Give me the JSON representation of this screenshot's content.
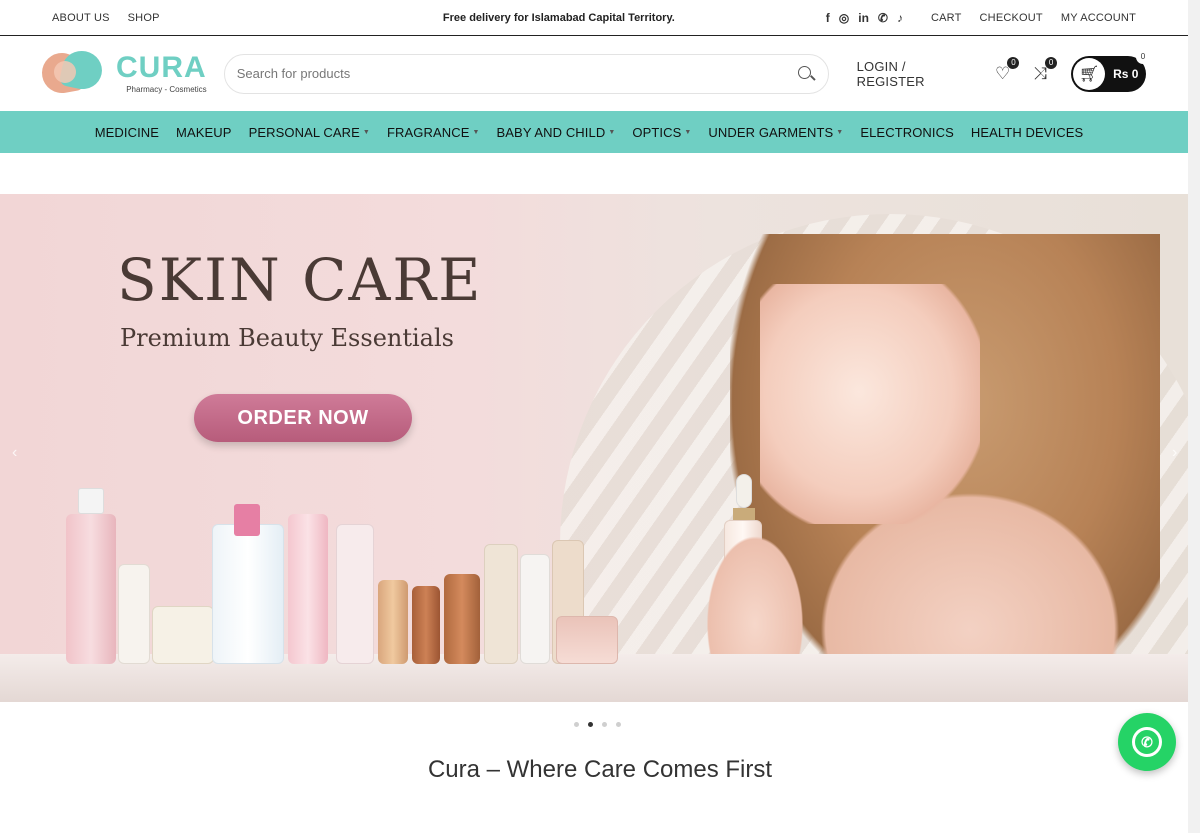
{
  "topbar": {
    "links_left": [
      "ABOUT US",
      "SHOP"
    ],
    "announcement": "Free delivery for Islamabad Capital Territory.",
    "social": [
      "facebook-icon",
      "instagram-icon",
      "linkedin-icon",
      "whatsapp-icon",
      "tiktok-icon"
    ],
    "social_glyphs": [
      "f",
      "◎",
      "in",
      "✆",
      "♪"
    ],
    "links_right": [
      "CART",
      "CHECKOUT",
      "MY ACCOUNT"
    ]
  },
  "header": {
    "brand": "CURA",
    "tagline": "Pharmacy - Cosmetics",
    "search_placeholder": "Search for products",
    "login_label": "LOGIN / REGISTER",
    "wishlist_count": "0",
    "compare_count": "0",
    "cart_amount": "Rs 0",
    "cart_count": "0"
  },
  "nav": {
    "items": [
      {
        "label": "MEDICINE",
        "dropdown": false
      },
      {
        "label": "MAKEUP",
        "dropdown": false
      },
      {
        "label": "PERSONAL CARE",
        "dropdown": true
      },
      {
        "label": "FRAGRANCE",
        "dropdown": true
      },
      {
        "label": "BABY AND CHILD",
        "dropdown": true
      },
      {
        "label": "OPTICS",
        "dropdown": true
      },
      {
        "label": "UNDER GARMENTS",
        "dropdown": true
      },
      {
        "label": "ELECTRONICS",
        "dropdown": false
      },
      {
        "label": "HEALTH DEVICES",
        "dropdown": false
      }
    ]
  },
  "hero": {
    "title": "SKIN CARE",
    "subtitle": "Premium Beauty Essentials",
    "cta": "ORDER NOW",
    "slide_count": 4,
    "active_slide": 2
  },
  "tagline": "Cura – Where Care Comes First",
  "colors": {
    "accent": "#6fcfc3",
    "cta": "#c46a8a",
    "whatsapp": "#25d366"
  }
}
